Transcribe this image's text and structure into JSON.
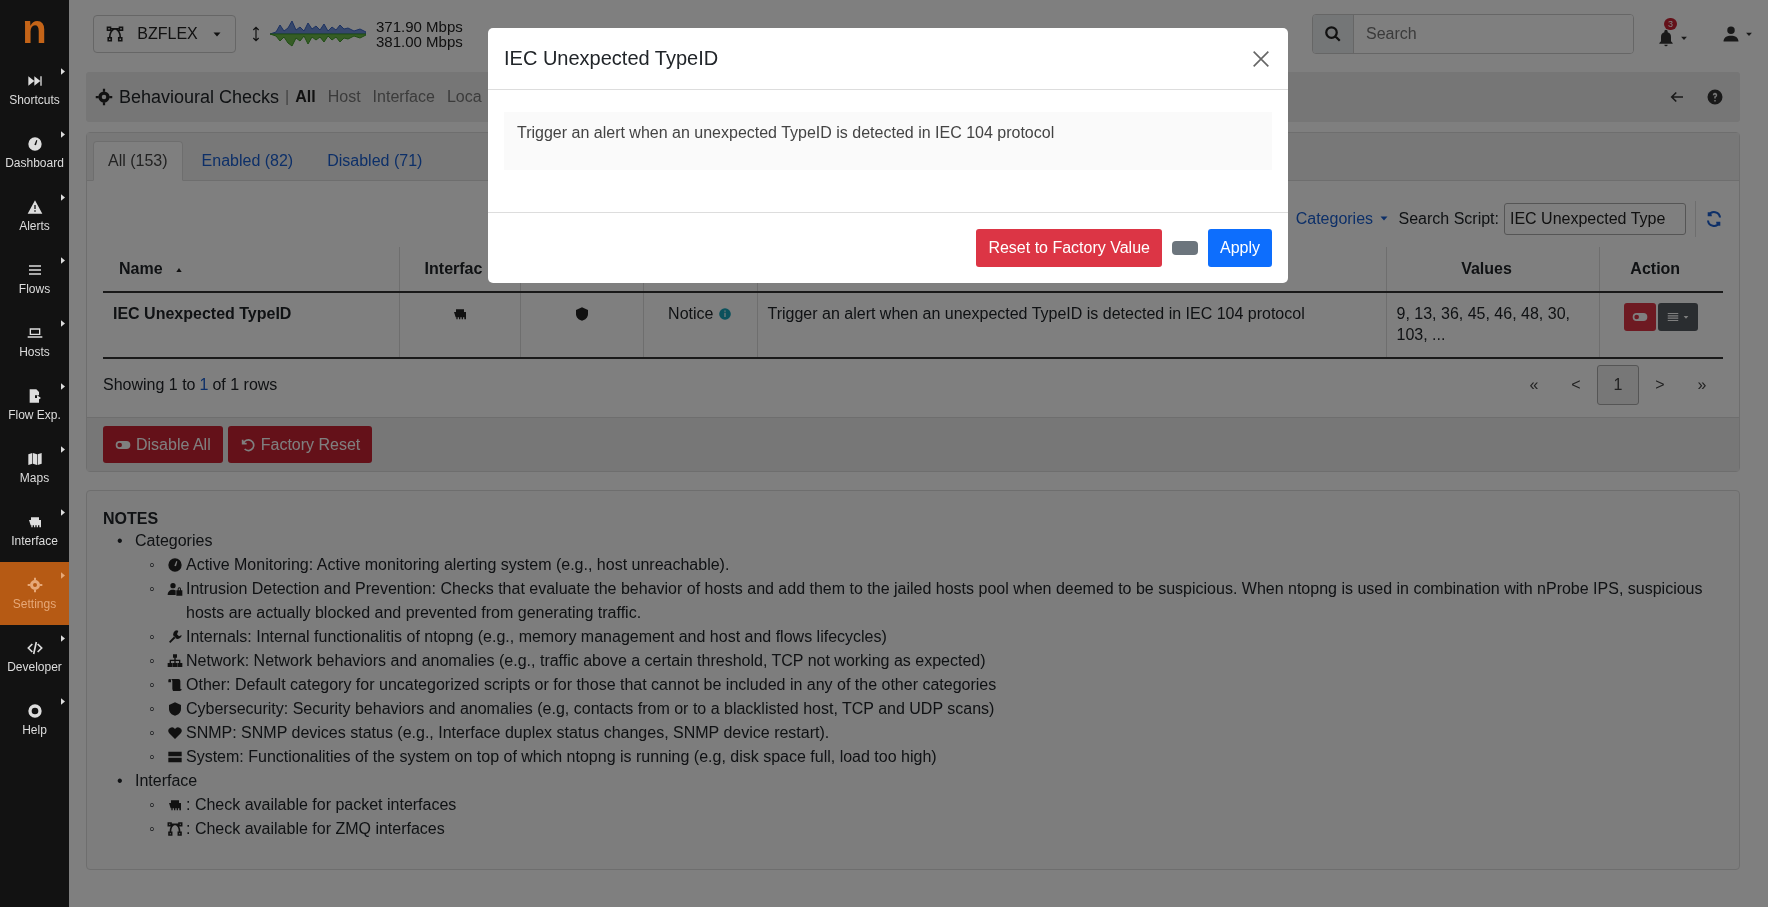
{
  "logo": "n",
  "sidebar": {
    "items": [
      {
        "label": "Shortcuts",
        "selected": false
      },
      {
        "label": "Dashboard",
        "selected": false
      },
      {
        "label": "Alerts",
        "selected": false
      },
      {
        "label": "Flows",
        "selected": false
      },
      {
        "label": "Hosts",
        "selected": false
      },
      {
        "label": "Flow Exp.",
        "selected": false
      },
      {
        "label": "Maps",
        "selected": false
      },
      {
        "label": "Interface",
        "selected": false
      },
      {
        "label": "Settings",
        "selected": true
      },
      {
        "label": "Developer",
        "selected": false
      },
      {
        "label": "Help",
        "selected": false
      }
    ]
  },
  "topbar": {
    "interface": "BZFLEX",
    "throughput_up": "371.90 Mbps",
    "throughput_down": "381.00 Mbps",
    "search": {
      "placeholder": "Search"
    },
    "notifications": "3"
  },
  "breadcrumb": {
    "title": "Behavioural Checks",
    "separator": "|",
    "links": [
      {
        "label": "All",
        "selected": true
      },
      {
        "label": "Host",
        "selected": false
      },
      {
        "label": "Interface",
        "selected": false
      },
      {
        "label": "Loca",
        "selected": false
      }
    ]
  },
  "tabs": [
    {
      "label": "All (153)",
      "selected": true
    },
    {
      "label": "Enabled (82)",
      "selected": false
    },
    {
      "label": "Disabled (71)",
      "selected": false
    }
  ],
  "toolbar": {
    "categories": "Categories",
    "search_label": "Search Script:",
    "search_value": "IEC Unexpected Type"
  },
  "table": {
    "header": {
      "name": "Name",
      "interface": "Interfac",
      "values": "Values",
      "action": "Action"
    },
    "rows": [
      {
        "name": "IEC Unexpected TypeID",
        "severity": "Notice",
        "description": "Trigger an alert when an unexpected TypeID is detected in IEC 104 protocol",
        "values": "9, 13, 36, 45, 46, 48, 30, 103, ..."
      }
    ]
  },
  "pagination": {
    "info_start": "Showing 1 to",
    "page_size": "1",
    "info_end": "of 1 rows",
    "pages": [
      {
        "label": "«",
        "selected": false
      },
      {
        "label": "<",
        "selected": false
      },
      {
        "label": "1",
        "selected": true
      },
      {
        "label": ">",
        "selected": false
      },
      {
        "label": "»",
        "selected": false
      }
    ]
  },
  "actions": [
    {
      "label": "Disable All",
      "kind": "toggle"
    },
    {
      "label": "Factory Reset",
      "kind": "reset"
    }
  ],
  "notes": {
    "title": "NOTES",
    "bullet": "•",
    "sub_bullet": "◦",
    "sections": [
      {
        "label": "Categories",
        "items": [
          "Active Monitoring: Active monitoring alerting system (e.g., host unreachable).",
          "Intrusion Detection and Prevention: Checks that evaluate the behavior of hosts and add them to the jailed hosts pool when deemed to be suspicious. When ntopng is used in combination with nProbe IPS, suspicious hosts are actually blocked and prevented from generating traffic.",
          "Internals: Internal functionalitis of ntopng (e.g., memory management and host and flows lifecycles)",
          "Network: Network behaviors and anomalies (e.g., traffic above a certain threshold, TCP not working as expected)",
          "Other: Default category for uncategorized scripts or for those that cannot be included in any of the other categories",
          "Cybersecurity: Security behaviors and anomalies (e.g, contacts from or to a blacklisted host, TCP and UDP scans)",
          "SNMP: SNMP devices status (e.g., Interface duplex status changes, SNMP device restart).",
          "System: Functionalities of the system on top of which ntopng is running (e.g, disk space full, load too high)"
        ]
      },
      {
        "label": "Interface",
        "items": [
          ": Check available for packet interfaces",
          ": Check available for ZMQ interfaces"
        ]
      }
    ]
  },
  "modal": {
    "title": "IEC Unexpected TypeID",
    "body": "Trigger an alert when an unexpected TypeID is detected in IEC 104 protocol",
    "buttons": [
      {
        "label": "Reset to Factory Value",
        "kind": "danger"
      },
      {
        "kind": "switch",
        "on": false
      },
      {
        "label": "Apply",
        "kind": "primary"
      }
    ]
  }
}
